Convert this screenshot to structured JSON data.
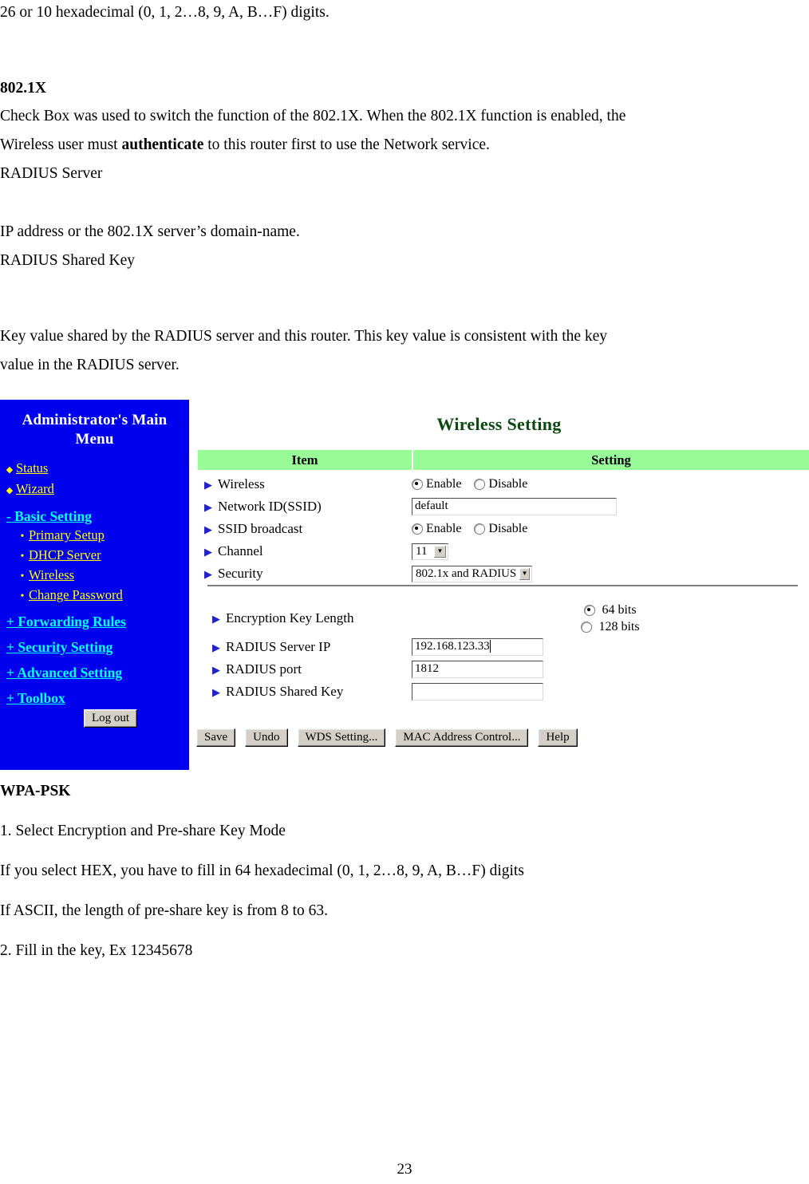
{
  "document": {
    "paragraphs": [
      {
        "id": "p1",
        "text": "26 or 10 hexadecimal (0, 1, 2…8, 9, A, B…F) digits.",
        "style": "normal"
      },
      {
        "id": "p2",
        "text": "802.1X",
        "style": "bold"
      },
      {
        "id": "p3a",
        "text": "Check Box was used to switch the function of the 802.1X. When the 802.1X function is enabled, the",
        "style": "normal"
      },
      {
        "id": "p3b_pre",
        "text": "Wireless user must ",
        "style": "normal"
      },
      {
        "id": "p3b_bold",
        "text": "authenticate",
        "style": "bold-inline"
      },
      {
        "id": "p3b_post",
        "text": " to this router first to use the Network service.",
        "style": "normal"
      },
      {
        "id": "p4",
        "text": "RADIUS Server",
        "style": "normal"
      },
      {
        "id": "p5",
        "text": "IP address or the 802.1X server’s domain-name.",
        "style": "normal"
      },
      {
        "id": "p6",
        "text": "RADIUS Shared Key",
        "style": "normal"
      },
      {
        "id": "p7",
        "text": "Key value shared by the RADIUS server and this router. This key value is consistent with the key",
        "style": "normal"
      },
      {
        "id": "p8",
        "text": "value in the RADIUS server.",
        "style": "normal"
      },
      {
        "id": "p9",
        "text": "WPA-PSK",
        "style": "bold"
      },
      {
        "id": "p10",
        "text": "1. Select Encryption and Pre-share Key Mode",
        "style": "normal"
      },
      {
        "id": "p11",
        "text": "If you select HEX, you have to fill in 64 hexadecimal (0, 1, 2…8, 9, A, B…F) digits",
        "style": "normal"
      },
      {
        "id": "p12",
        "text": "If ASCII, the length of pre-share key is from 8 to 63.",
        "style": "normal"
      },
      {
        "id": "p13",
        "text": "2. Fill in the key, Ex 12345678",
        "style": "normal"
      }
    ],
    "page_number": "23"
  },
  "router_ui": {
    "sidebar": {
      "title": "Administrator's Main Menu",
      "background_color": "#0000ee",
      "link_color": "#ffff00",
      "section_color": "#00ffff",
      "top_items": [
        {
          "label": "Status",
          "marker": "◆"
        },
        {
          "label": "Wizard",
          "marker": "◆"
        }
      ],
      "basic_setting": {
        "label": "- Basic Setting",
        "children": [
          {
            "label": "Primary Setup",
            "marker": "•"
          },
          {
            "label": "DHCP Server",
            "marker": "•"
          },
          {
            "label": "Wireless",
            "marker": "•"
          },
          {
            "label": "Change Password",
            "marker": "•"
          }
        ]
      },
      "sections": [
        {
          "label": "+ Forwarding Rules"
        },
        {
          "label": "+ Security Setting"
        },
        {
          "label": "+ Advanced Setting"
        },
        {
          "label": "+ Toolbox"
        }
      ],
      "logout_label": "Log out"
    },
    "panel": {
      "title": "Wireless Setting",
      "title_color": "#0a4a10",
      "header_background": "#98fb98",
      "columns": {
        "item": "Item",
        "setting": "Setting"
      },
      "rows": [
        {
          "label": "Wireless",
          "type": "radio",
          "options": [
            {
              "label": "Enable",
              "selected": true
            },
            {
              "label": "Disable",
              "selected": false
            }
          ]
        },
        {
          "label": "Network ID(SSID)",
          "type": "text",
          "value": "default"
        },
        {
          "label": "SSID broadcast",
          "type": "radio",
          "options": [
            {
              "label": "Enable",
              "selected": true
            },
            {
              "label": "Disable",
              "selected": false
            }
          ]
        },
        {
          "label": "Channel",
          "type": "select",
          "value": "11"
        },
        {
          "label": "Security",
          "type": "select",
          "value": "802.1x and RADIUS"
        }
      ],
      "rows2": [
        {
          "label": "Encryption Key Length",
          "type": "radio-stacked",
          "options": [
            {
              "label": "64 bits",
              "selected": true
            },
            {
              "label": "128 bits",
              "selected": false
            }
          ]
        },
        {
          "label": "RADIUS Server IP",
          "type": "text",
          "value": "192.168.123.33",
          "has_caret": true
        },
        {
          "label": "RADIUS port",
          "type": "text",
          "value": "1812"
        },
        {
          "label": "RADIUS Shared Key",
          "type": "text",
          "value": ""
        }
      ],
      "buttons": [
        {
          "label": "Save"
        },
        {
          "label": "Undo"
        },
        {
          "label": "WDS Setting..."
        },
        {
          "label": "MAC Address Control..."
        },
        {
          "label": "Help"
        }
      ]
    }
  }
}
